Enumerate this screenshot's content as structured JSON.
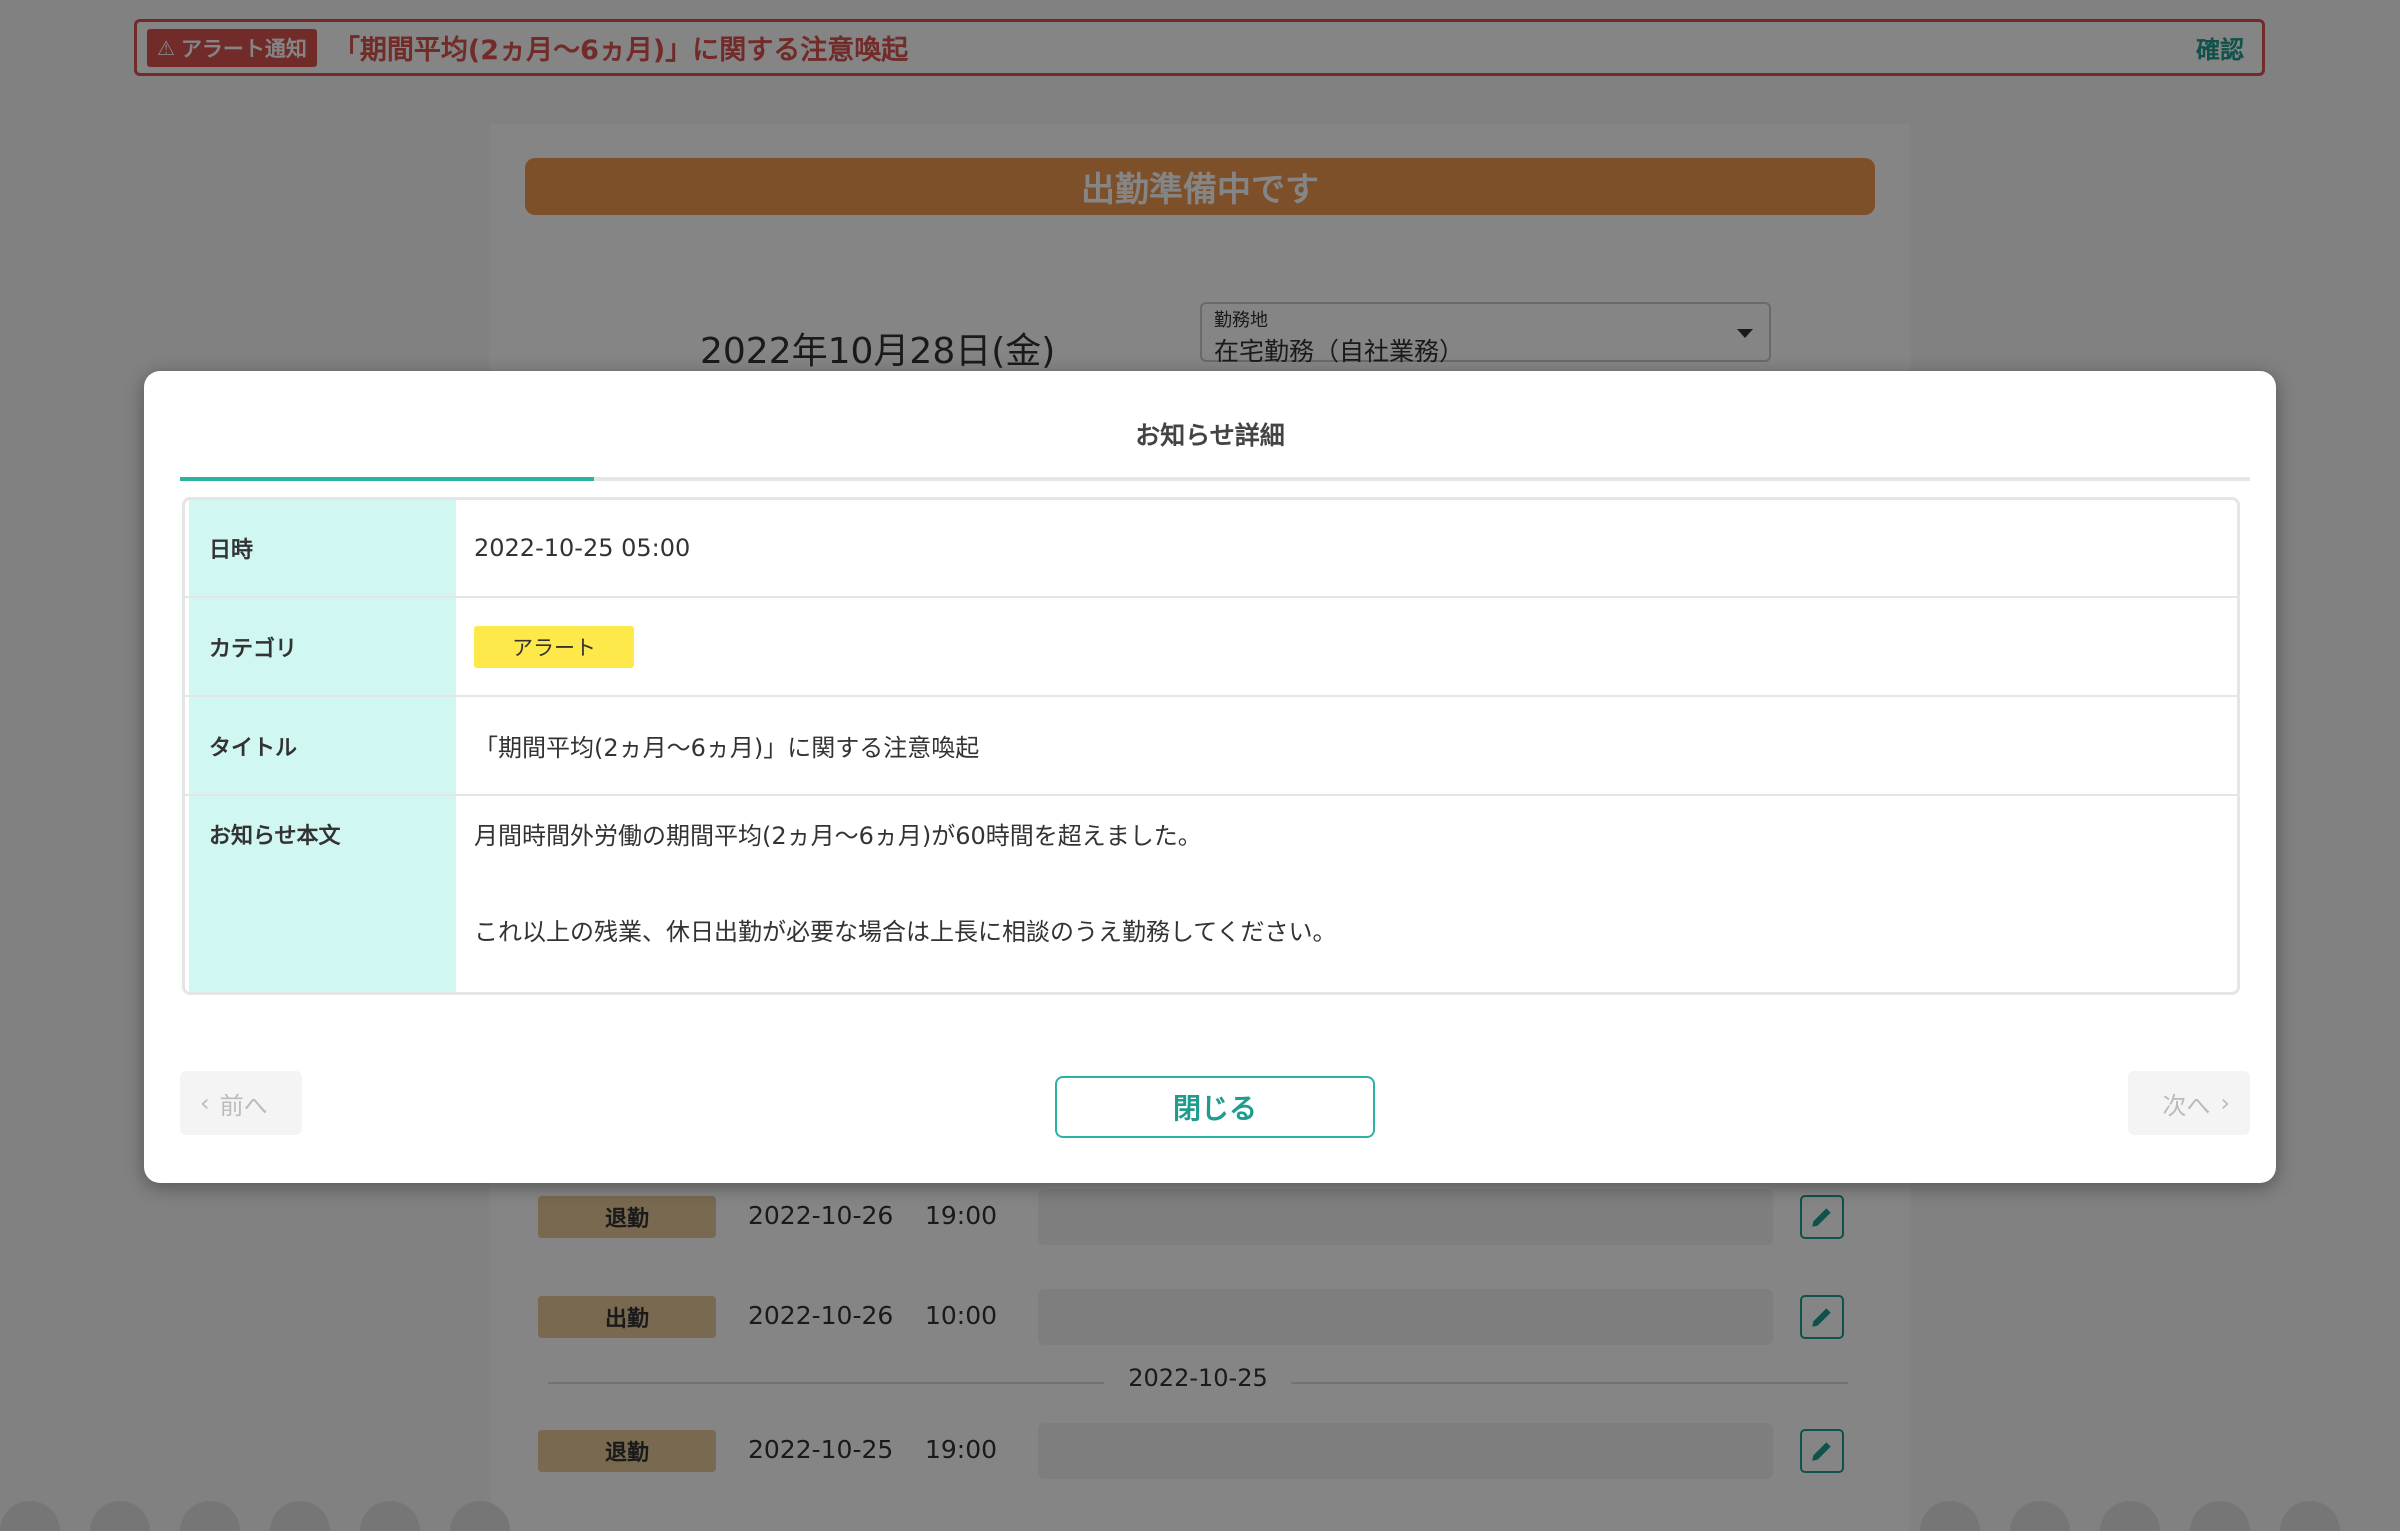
{
  "alert_banner": {
    "tag": "アラート通知",
    "text": "「期間平均(2ヵ月〜6ヵ月)」に関する注意喚起",
    "confirm_label": "確認"
  },
  "main": {
    "status": "出勤準備中です",
    "date": "2022年10月28日(金)",
    "location": {
      "label": "勤務地",
      "value": "在宅勤務（自社業務）"
    },
    "history": [
      {
        "type": "退勤",
        "date": "2022-10-26",
        "time": "19:00"
      },
      {
        "type": "出勤",
        "date": "2022-10-26",
        "time": "10:00"
      },
      {
        "type": "退勤",
        "date": "2022-10-25",
        "time": "19:00"
      }
    ],
    "divider_date": "2022-10-25"
  },
  "modal": {
    "title": "お知らせ詳細",
    "rows": {
      "datetime_label": "日時",
      "datetime_value": "2022-10-25 05:00",
      "category_label": "カテゴリ",
      "category_value": "アラート",
      "title_label": "タイトル",
      "title_value": "「期間平均(2ヵ月〜6ヵ月)」に関する注意喚起",
      "body_label": "お知らせ本文",
      "body_line1": "月間時間外労働の期間平均(2ヵ月〜6ヵ月)が60時間を超えました。",
      "body_line2": "これ以上の残業、休日出勤が必要な場合は上長に相談のうえ勤務してください。"
    },
    "prev_label": "前へ",
    "next_label": "次へ",
    "close_label": "閉じる"
  },
  "colors": {
    "accent": "#2ab3a3",
    "alert": "#d9534f",
    "status": "#f09a52",
    "header_cell": "#d1f7f2",
    "category_badge": "#ffe84a"
  }
}
